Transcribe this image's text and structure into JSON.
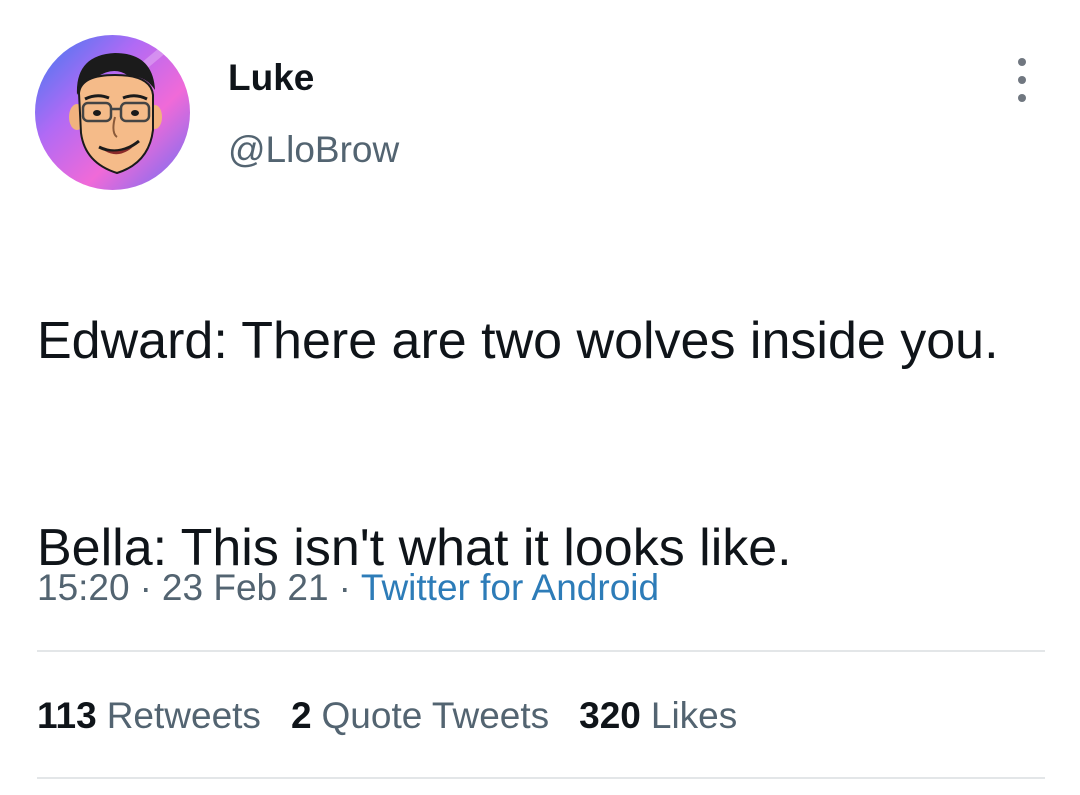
{
  "author": {
    "display_name": "Luke",
    "handle": "@LloBrow",
    "avatar_icon": "cartoon-face-avatar"
  },
  "menu": {
    "icon": "more-vertical-icon"
  },
  "tweet": {
    "paragraphs": [
      "Edward: There are two wolves inside you.",
      "Bella: This isn't what it looks like."
    ]
  },
  "meta": {
    "time": "15:20",
    "separator": "·",
    "date": "23 Feb 21",
    "source": "Twitter for Android"
  },
  "stats": {
    "retweets": {
      "count": "113",
      "label": "Retweets"
    },
    "quote_tweets": {
      "count": "2",
      "label": "Quote Tweets"
    },
    "likes": {
      "count": "320",
      "label": "Likes"
    }
  },
  "colors": {
    "text_primary": "#0f1419",
    "text_secondary": "#536471",
    "link": "#2d7cb8",
    "divider": "#e3e6e8"
  }
}
